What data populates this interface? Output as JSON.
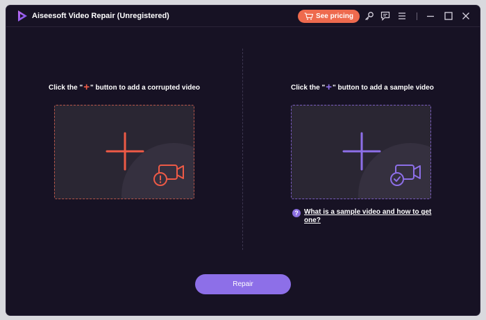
{
  "titlebar": {
    "title": "Aiseesoft Video Repair (Unregistered)",
    "pricing_label": "See pricing",
    "icons": [
      "app-logo-icon",
      "cart-icon",
      "key-icon",
      "feedback-icon",
      "menu-icon",
      "minimize-icon",
      "maximize-icon",
      "close-icon"
    ]
  },
  "left_panel": {
    "prompt_before": "Click the \"",
    "prompt_plus": "+",
    "prompt_after": "\" button to add a corrupted video",
    "accent": "#ee5a46"
  },
  "right_panel": {
    "prompt_before": "Click the \"",
    "prompt_plus": "+",
    "prompt_after": "\" button to add a sample video",
    "accent": "#8d6fe8",
    "help_icon_text": "?",
    "help_link": "What is a sample video and how to get one?"
  },
  "footer": {
    "repair_label": "Repair"
  },
  "colors": {
    "background": "#171224",
    "dropzone": "#2a2633",
    "pricing_button": "#ee6a4e",
    "repair_button": "#8d6fe8"
  }
}
